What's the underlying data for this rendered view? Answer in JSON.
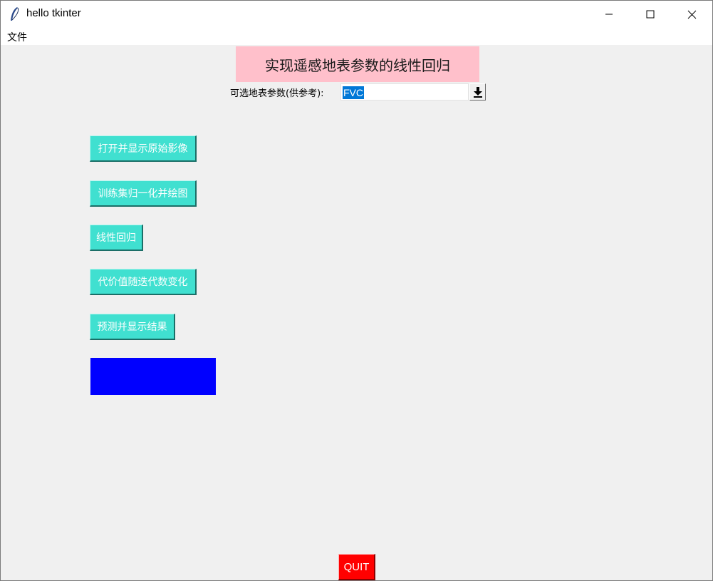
{
  "window": {
    "title": "hello tkinter",
    "icon": "feather-icon"
  },
  "menubar": {
    "items": [
      {
        "label": "文件"
      }
    ]
  },
  "header": {
    "title": "实现遥感地表参数的线性回归",
    "background": "#ffc0cb"
  },
  "param_select": {
    "label": "可选地表参数(供参考):",
    "value": "FVC",
    "arrow_icon": "download-arrow-icon"
  },
  "actions": {
    "buttons": [
      {
        "label": "打开并显示原始影像"
      },
      {
        "label": "训练集归一化并绘图"
      },
      {
        "label": "线性回归"
      },
      {
        "label": "代价值随迭代数变化"
      },
      {
        "label": "预测并显示结果"
      }
    ],
    "color": "#40e0d0"
  },
  "canvas": {
    "color": "#0000ff"
  },
  "quit": {
    "label": "QUIT",
    "color": "#ff0000"
  }
}
